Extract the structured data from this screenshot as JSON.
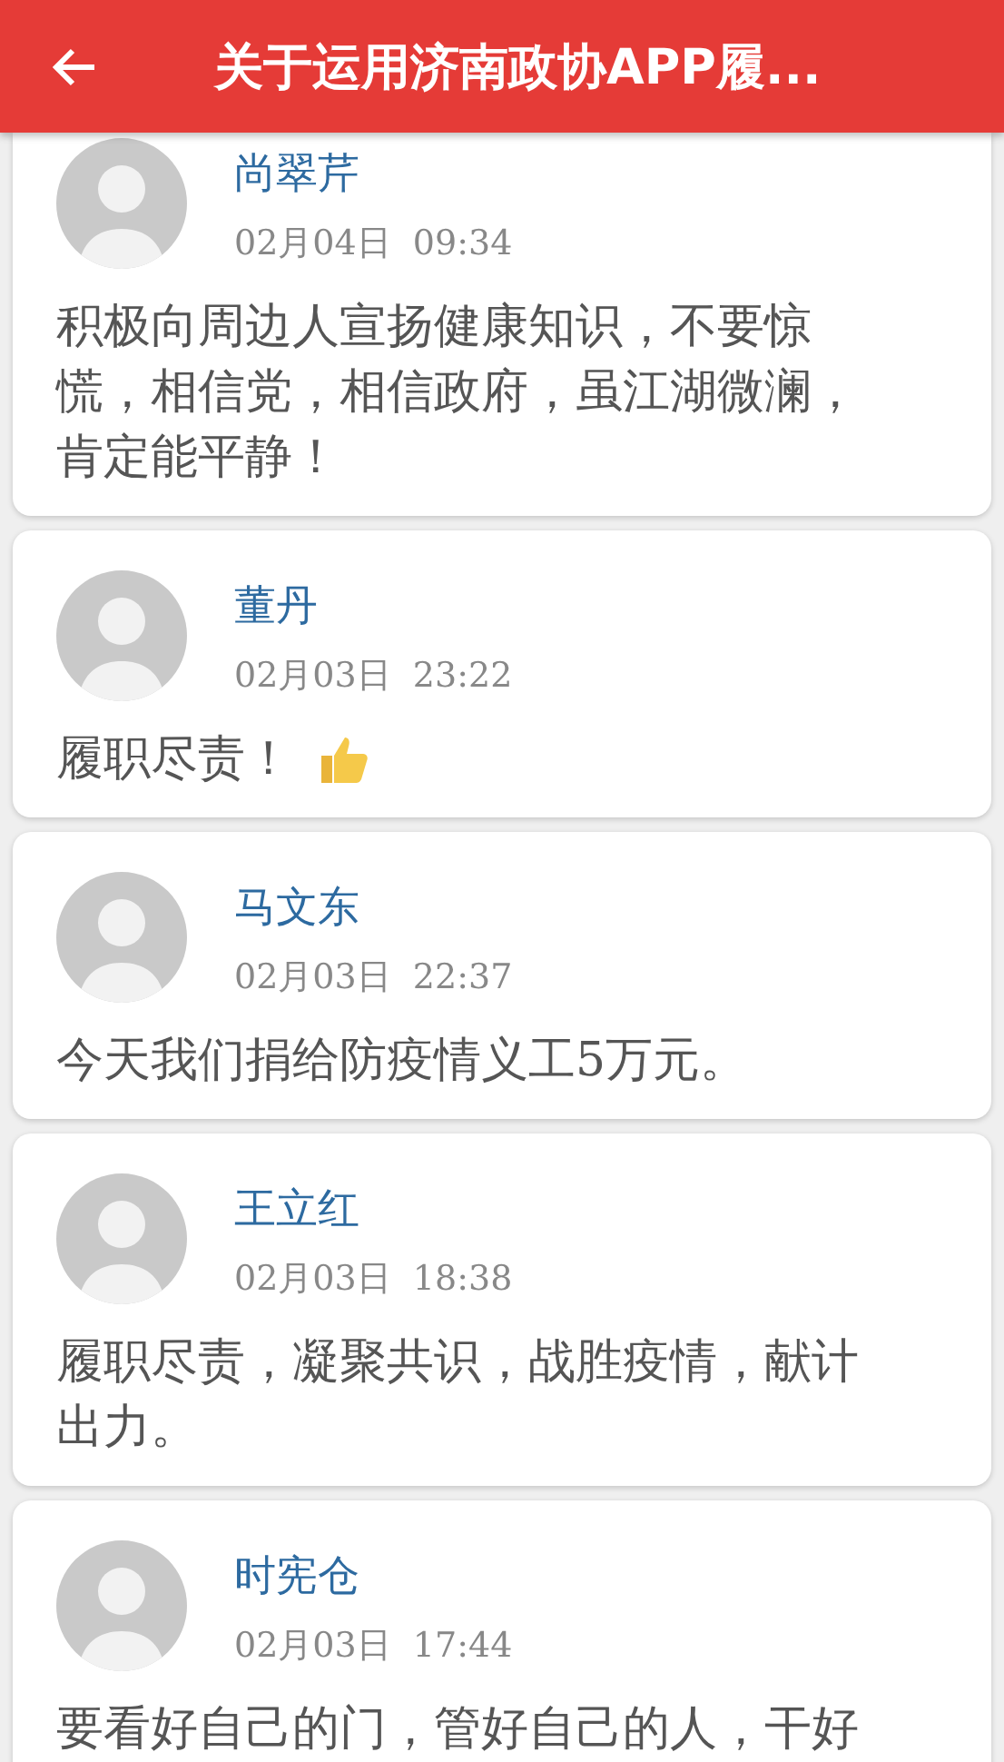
{
  "header": {
    "title": "关于运用济南政协APP履..."
  },
  "posts": [
    {
      "name": "尚翠芹",
      "time": "02月04日  09:34",
      "text": "积极向周边人宣扬健康知识，不要惊慌，相信党，相信政府，虽江湖微澜，肯定能平静！",
      "thumbs_up": false
    },
    {
      "name": "董丹",
      "time": "02月03日  23:22",
      "text": "履职尽责！",
      "thumbs_up": true
    },
    {
      "name": "马文东",
      "time": "02月03日  22:37",
      "text": "今天我们捐给防疫情义工5万元。",
      "thumbs_up": false
    },
    {
      "name": "王立红",
      "time": "02月03日  18:38",
      "text": "履职尽责，凝聚共识，战胜疫情，献计出力。",
      "thumbs_up": false
    },
    {
      "name": "时宪仓",
      "time": "02月03日  17:44",
      "text": "要看好自己的门，管好自己的人，干好",
      "thumbs_up": false
    }
  ]
}
